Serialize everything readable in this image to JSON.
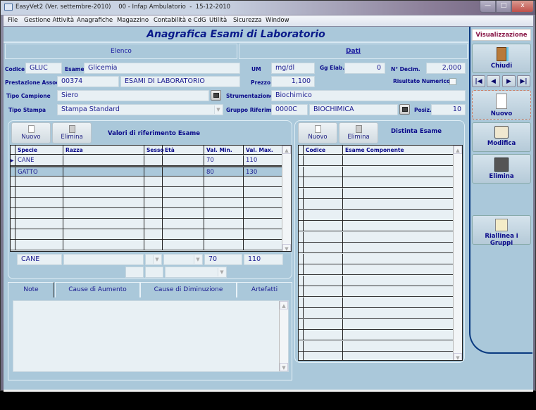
{
  "window": {
    "title": "EasyVet2 (Ver. settembre-2010)    00 - Infap Ambulatorio  -  15-12-2010",
    "controls": {
      "minimize": "—",
      "maximize": "□",
      "close": "x"
    }
  },
  "menu": [
    "File",
    "Gestione Attività",
    "Anagrafiche",
    "Magazzino",
    "Contabilità e CdG",
    "Utilità",
    "Sicurezza",
    "Window"
  ],
  "form": {
    "title": "Anagrafica Esami di Laboratorio",
    "section_left": "Elenco",
    "section_right": "Dati",
    "codice_label": "Codice",
    "codice_value": "GLUC",
    "esame_label": "Esame",
    "esame_value": "Glicemia",
    "um_label": "UM",
    "um_value": "mg/dl",
    "gg_elab_label": "Gg Elab.",
    "gg_elab_value": "0",
    "n_decim_label": "N° Decim.",
    "n_decim_value": "2,000",
    "prestazione_label": "Prestazione Assoc.",
    "prestazione_code": "00374",
    "prestazione_desc": "ESAMI DI LABORATORIO",
    "prezzo_label": "Prezzo",
    "prezzo_value": "1,100",
    "risultato_label": "Risultato Numerico",
    "risultato_checked": false,
    "tipo_campione_label": "Tipo Campione",
    "tipo_campione_value": "Siero",
    "strumentazione_label": "Strumentazione",
    "strumentazione_value": "Biochimico",
    "tipo_stampa_label": "Tipo Stampa",
    "tipo_stampa_value": "Stampa Standard",
    "gruppo_label": "Gruppo Riferim.",
    "gruppo_code": "0000C",
    "gruppo_desc": "BIOCHIMICA",
    "posiz_label": "Posiz.",
    "posiz_value": "10"
  },
  "ref_values": {
    "title": "Valori di riferimento Esame",
    "new_label": "Nuovo",
    "delete_label": "Elimina",
    "columns": [
      "Specie",
      "Razza",
      "Sesso",
      "Età",
      "Val. Min.",
      "Val. Max."
    ],
    "rows": [
      {
        "specie": "CANE",
        "razza": "",
        "sesso": "",
        "eta": "",
        "min": "70",
        "max": "110"
      },
      {
        "specie": "GATTO",
        "razza": "",
        "sesso": "",
        "eta": "",
        "min": "80",
        "max": "130"
      }
    ],
    "edit": {
      "specie": "CANE",
      "razza": "",
      "sesso": "",
      "eta": "",
      "min": "70",
      "max": "110"
    }
  },
  "components": {
    "title": "Distinta Esame",
    "new_label": "Nuovo",
    "delete_label": "Elimina",
    "columns": [
      "Codice",
      "Esame Componente"
    ]
  },
  "tabs": [
    "Note",
    "Cause di Aumento",
    "Cause di Diminuzione",
    "Artefatti"
  ],
  "sidebar": {
    "mode": "Visualizzazione",
    "close": "Chiudi",
    "nav": [
      "|◀",
      "◀",
      "▶",
      "▶|"
    ],
    "new": "Nuovo",
    "edit": "Modifica",
    "delete": "Elimina",
    "realign": "Riallinea i Gruppi"
  }
}
